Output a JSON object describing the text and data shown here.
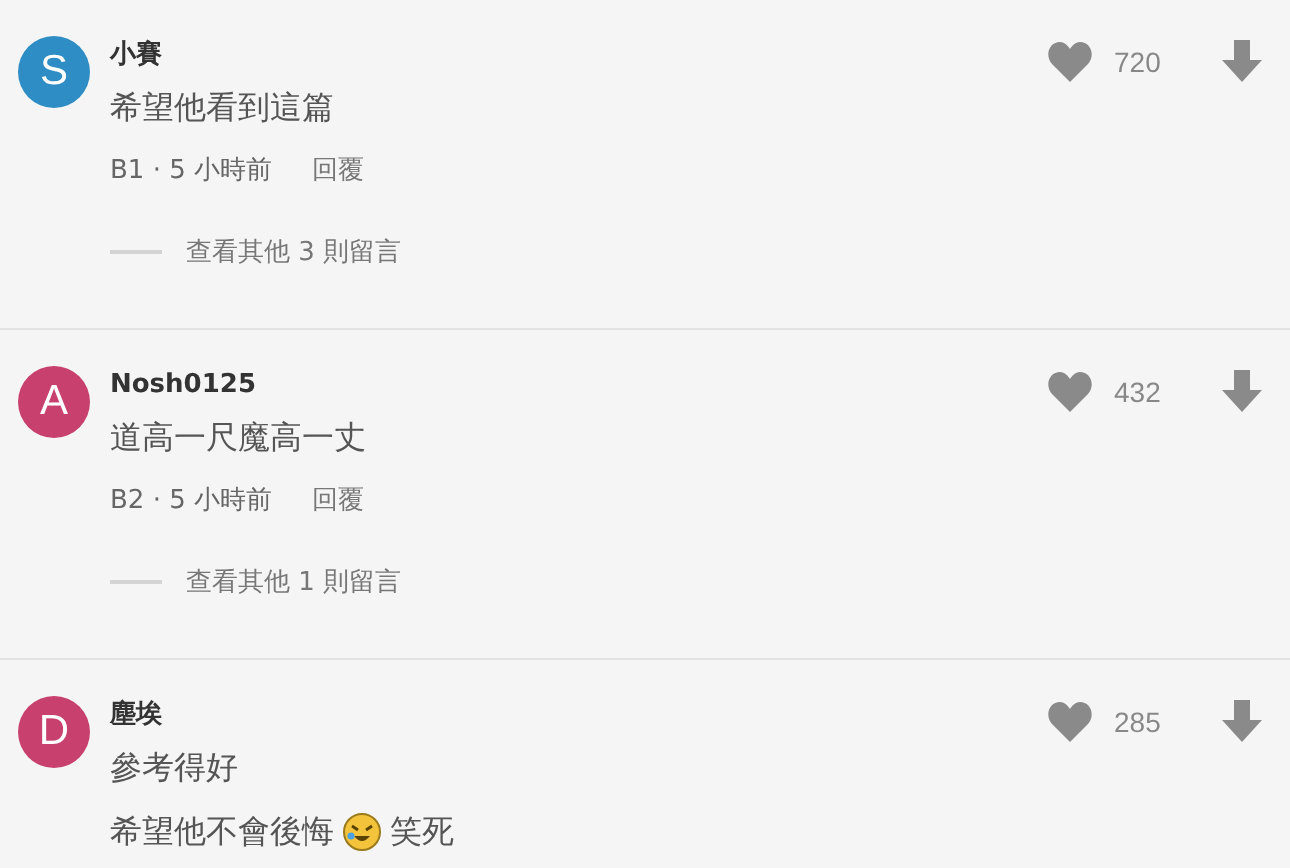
{
  "comments": [
    {
      "avatar": {
        "letter": "S",
        "color": "#2e8dc4"
      },
      "author": "小賽",
      "likes": "720",
      "body": [
        [
          {
            "kind": "text",
            "text": "希望他看到這篇"
          }
        ]
      ],
      "meta": "B1 · 5 小時前",
      "reply": "回覆",
      "more_replies": "查看其他 3 則留言"
    },
    {
      "avatar": {
        "letter": "A",
        "color": "#c8406d"
      },
      "author": "Nosh0125",
      "likes": "432",
      "body": [
        [
          {
            "kind": "text",
            "text": "道高一尺魔高一丈"
          }
        ]
      ],
      "meta": "B2 · 5 小時前",
      "reply": "回覆",
      "more_replies": "查看其他 1 則留言"
    },
    {
      "avatar": {
        "letter": "D",
        "color": "#c8406d"
      },
      "author": "塵埃",
      "likes": "285",
      "body": [
        [
          {
            "kind": "text",
            "text": "參考得好"
          }
        ],
        [
          {
            "kind": "text",
            "text": "希望他不會後悔"
          },
          {
            "kind": "emoji"
          },
          {
            "kind": "text",
            "text": "笑死"
          }
        ]
      ]
    }
  ]
}
